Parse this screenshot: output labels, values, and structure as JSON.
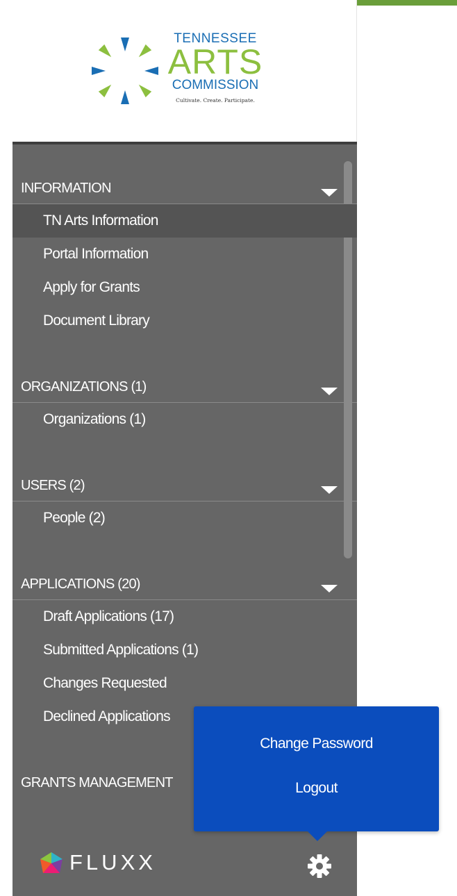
{
  "logo": {
    "line1": "TENNESSEE",
    "line2": "ARTS",
    "line3": "COMMISSION",
    "tagline": "Cultivate. Create. Participate."
  },
  "sections": [
    {
      "title": "INFORMATION",
      "items": [
        "TN Arts Information",
        "Portal Information",
        "Apply for Grants",
        "Document Library"
      ]
    },
    {
      "title": "ORGANIZATIONS (1)",
      "items": [
        "Organizations  (1)"
      ]
    },
    {
      "title": "USERS (2)",
      "items": [
        "People  (2)"
      ]
    },
    {
      "title": "APPLICATIONS (20)",
      "items": [
        "Draft Applications  (17)",
        "Submitted Applications  (1)",
        "Changes Requested",
        "Declined Applications"
      ]
    },
    {
      "title": "GRANTS MANAGEMENT",
      "items": []
    }
  ],
  "footer": {
    "brand": "FLUXX"
  },
  "popup": {
    "change_password": "Change Password",
    "logout": "Logout"
  },
  "colors": {
    "sidebar": "#666666",
    "active_item": "#545454",
    "popup": "#0b4dbd",
    "logo_blue": "#1a6eb4",
    "logo_green": "#8cbf3f",
    "accent": "#6a9e3a"
  }
}
